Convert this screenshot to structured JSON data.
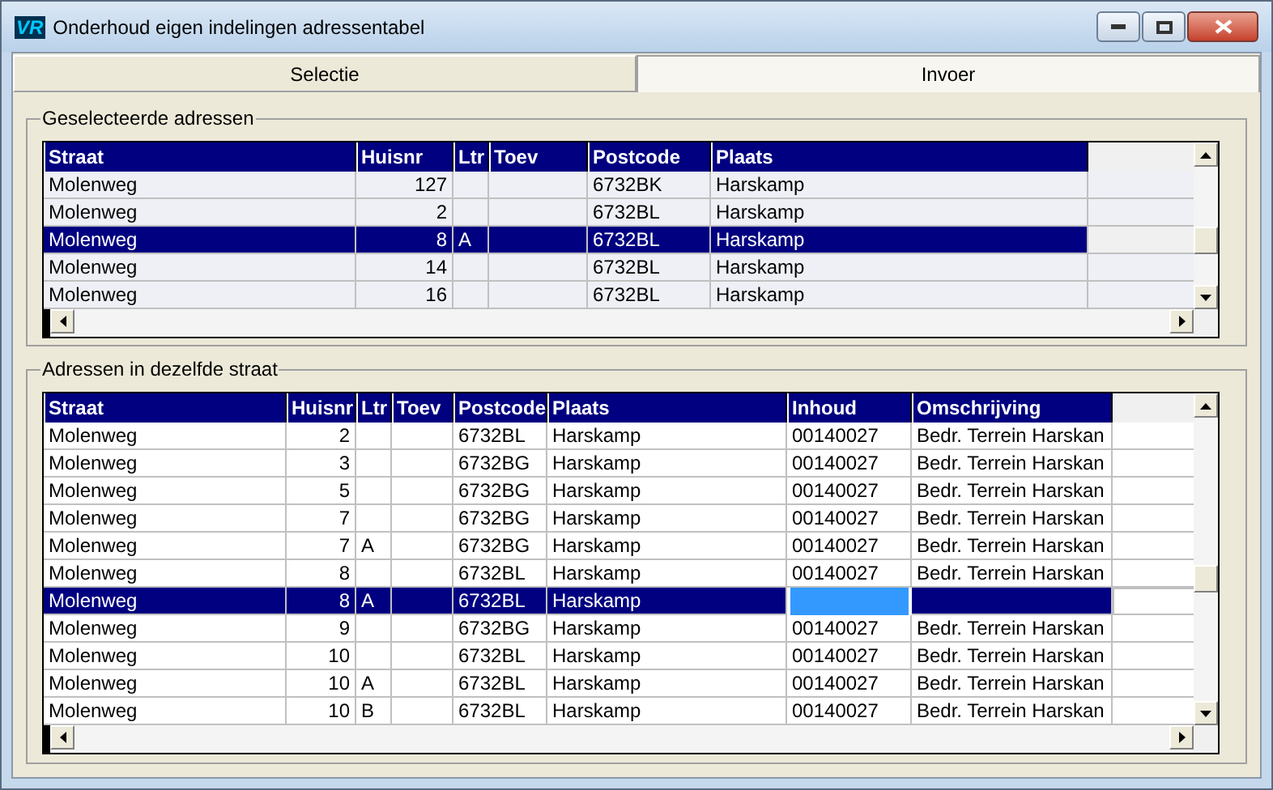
{
  "window": {
    "title": "Onderhoud eigen indelingen adressentabel",
    "logo": "VR"
  },
  "tabs": [
    {
      "label": "Selectie",
      "selected": false
    },
    {
      "label": "Invoer",
      "selected": true
    }
  ],
  "selected_addresses": {
    "title": "Geselecteerde adressen",
    "columns": [
      {
        "label": "Straat"
      },
      {
        "label": "Huisnr"
      },
      {
        "label": "Ltr"
      },
      {
        "label": "Toev"
      },
      {
        "label": "Postcode"
      },
      {
        "label": "Plaats"
      }
    ],
    "rows": [
      {
        "straat": "Molenweg",
        "huisnr": "127",
        "postcode": "6732BK",
        "plaats": "Harskamp",
        "selected": false
      },
      {
        "straat": "Molenweg",
        "huisnr": "2",
        "postcode": "6732BL",
        "plaats": "Harskamp",
        "selected": false
      },
      {
        "straat": "Molenweg",
        "huisnr": "8",
        "ltr": "A",
        "postcode": "6732BL",
        "plaats": "Harskamp",
        "selected": true
      },
      {
        "straat": "Molenweg",
        "huisnr": "14",
        "postcode": "6732BL",
        "plaats": "Harskamp",
        "selected": false
      },
      {
        "straat": "Molenweg",
        "huisnr": "16",
        "postcode": "6732BL",
        "plaats": "Harskamp",
        "selected": false
      }
    ]
  },
  "same_street": {
    "title": "Adressen in dezelfde straat",
    "columns": [
      {
        "label": "Straat"
      },
      {
        "label": "Huisnr"
      },
      {
        "label": "Ltr"
      },
      {
        "label": "Toev"
      },
      {
        "label": "Postcode"
      },
      {
        "label": "Plaats"
      },
      {
        "label": "Inhoud"
      },
      {
        "label": "Omschrijving"
      }
    ],
    "rows": [
      {
        "straat": "Molenweg",
        "huisnr": "2",
        "postcode": "6732BL",
        "plaats": "Harskamp",
        "inhoud": "00140027",
        "omschrijving": "Bedr. Terrein Harskan",
        "selected": false
      },
      {
        "straat": "Molenweg",
        "huisnr": "3",
        "postcode": "6732BG",
        "plaats": "Harskamp",
        "inhoud": "00140027",
        "omschrijving": "Bedr. Terrein Harskan",
        "selected": false
      },
      {
        "straat": "Molenweg",
        "huisnr": "5",
        "postcode": "6732BG",
        "plaats": "Harskamp",
        "inhoud": "00140027",
        "omschrijving": "Bedr. Terrein Harskan",
        "selected": false
      },
      {
        "straat": "Molenweg",
        "huisnr": "7",
        "postcode": "6732BG",
        "plaats": "Harskamp",
        "inhoud": "00140027",
        "omschrijving": "Bedr. Terrein Harskan",
        "selected": false
      },
      {
        "straat": "Molenweg",
        "huisnr": "7",
        "ltr": "A",
        "postcode": "6732BG",
        "plaats": "Harskamp",
        "inhoud": "00140027",
        "omschrijving": "Bedr. Terrein Harskan",
        "selected": false
      },
      {
        "straat": "Molenweg",
        "huisnr": "8",
        "postcode": "6732BL",
        "plaats": "Harskamp",
        "inhoud": "00140027",
        "omschrijving": "Bedr. Terrein Harskan",
        "selected": false
      },
      {
        "straat": "Molenweg",
        "huisnr": "8",
        "ltr": "A",
        "postcode": "6732BL",
        "plaats": "Harskamp",
        "selected": true
      },
      {
        "straat": "Molenweg",
        "huisnr": "9",
        "postcode": "6732BG",
        "plaats": "Harskamp",
        "inhoud": "00140027",
        "omschrijving": "Bedr. Terrein Harskan",
        "selected": false
      },
      {
        "straat": "Molenweg",
        "huisnr": "10",
        "postcode": "6732BL",
        "plaats": "Harskamp",
        "inhoud": "00140027",
        "omschrijving": "Bedr. Terrein Harskan",
        "selected": false
      },
      {
        "straat": "Molenweg",
        "huisnr": "10",
        "ltr": "A",
        "postcode": "6732BL",
        "plaats": "Harskamp",
        "inhoud": "00140027",
        "omschrijving": "Bedr. Terrein Harskan",
        "selected": false
      },
      {
        "straat": "Molenweg",
        "huisnr": "10",
        "ltr": "B",
        "postcode": "6732BL",
        "plaats": "Harskamp",
        "inhoud": "00140027",
        "omschrijving": "Bedr. Terrein Harskan",
        "selected": false
      }
    ]
  }
}
